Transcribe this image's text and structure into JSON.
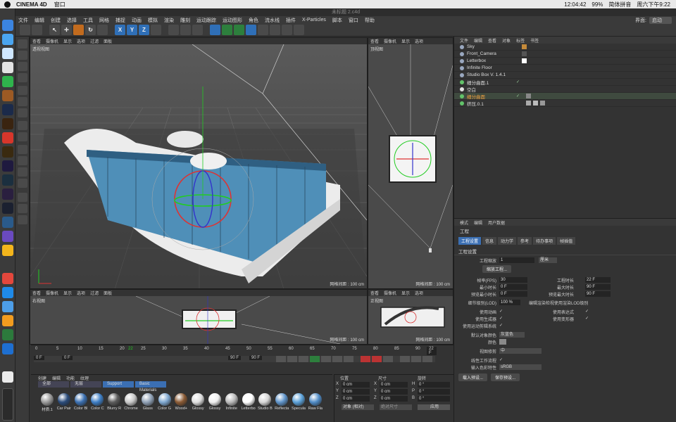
{
  "mac": {
    "app_name": "CINEMA 4D",
    "menu_window": "窗口",
    "time": "12:04:42",
    "battery": "99%",
    "input_method": "简体拼音",
    "clock": "周六下午9:22"
  },
  "window": {
    "title": "未标题 2.c4d"
  },
  "menu": [
    "文件",
    "编辑",
    "创建",
    "选择",
    "工具",
    "网格",
    "捕捉",
    "动画",
    "模拟",
    "渲染",
    "雕刻",
    "运动跟踪",
    "运动图形",
    "角色",
    "流水线",
    "插件",
    "X-Particles",
    "脚本",
    "窗口",
    "帮助"
  ],
  "layout": {
    "label": "界面:",
    "value": "启动"
  },
  "toolbar": {
    "axis_x": "X",
    "axis_y": "Y",
    "axis_z": "Z"
  },
  "viewports": {
    "perspective": {
      "menu": [
        "查看",
        "摄像机",
        "显示",
        "选项",
        "过滤",
        "面板"
      ],
      "label": "透视视图",
      "grid": "网格间距 : 100 cm"
    },
    "top": {
      "menu": [
        "查看",
        "摄像机",
        "显示",
        "选项",
        "过滤",
        "面板"
      ],
      "label": "顶视图",
      "grid": "网格间距 : 100 cm"
    },
    "right": {
      "menu": [
        "查看",
        "摄像机",
        "显示",
        "选项",
        "过滤",
        "面板"
      ],
      "label": "右视图",
      "grid": "网格间距 : 100 cm"
    },
    "front": {
      "menu": [
        "查看",
        "摄像机",
        "显示",
        "选项",
        "过滤",
        "面板"
      ],
      "label": "正视图",
      "grid": "网格间距 : 100 cm"
    }
  },
  "object_manager": {
    "menu": [
      "文件",
      "编辑",
      "查看",
      "对象",
      "标签",
      "书签"
    ],
    "objects": [
      {
        "name": "Sky",
        "color": "#9aa8c0"
      },
      {
        "name": "Front_Camera",
        "color": "#9aa8c0"
      },
      {
        "name": "Letterbox",
        "color": "#9aa8c0"
      },
      {
        "name": "Infinite Floor",
        "color": "#9aa8c0"
      },
      {
        "name": "Studio Box V. 1.4.1",
        "color": "#9aa8c0"
      },
      {
        "name": "细分曲面.1",
        "color": "#62c36a"
      },
      {
        "name": "空白",
        "color": "#e0e0e0"
      },
      {
        "name": "细分曲面",
        "color": "#62c36a"
      },
      {
        "name": "挤压.0.1",
        "color": "#62c36a"
      }
    ]
  },
  "attribute_manager": {
    "menu": [
      "模式",
      "编辑",
      "用户数据"
    ],
    "title": "工程",
    "tabs": [
      "工程设置",
      "信息",
      "动力学",
      "参考",
      "待办事项",
      "帧插值"
    ],
    "section": "工程设置",
    "rows": {
      "scale_label": "工程缩放",
      "scale_value": "1",
      "scale_unit": "厘米",
      "scale_btn": "缩放工程...",
      "fps_label": "帧率(FPS)",
      "fps_value": "30",
      "duration_label": "工程时长",
      "duration_value": "22 F",
      "min_label": "最小时长",
      "min_value": "0 F",
      "max_label": "最大时长",
      "max_value": "90 F",
      "pmin_label": "预览最小时长",
      "pmin_value": "0 F",
      "pmax_label": "预览最大时长",
      "pmax_value": "90 F",
      "lod_label": "细节级别(LOD)",
      "lod_value": "100 %",
      "lod_check": "编辑渲染检视使用渲染LOD级别",
      "use_anim": "使用动画",
      "use_expr": "使用表达式",
      "use_gen": "使用生成器",
      "use_deform": "使用变形器",
      "use_motion": "使用运动剪辑系统",
      "obj_color_label": "默认对象颜色",
      "obj_color_value": "灰蓝色",
      "color_label": "颜色",
      "view_clip_label": "视图修剪",
      "view_clip_value": "中",
      "linear_label": "线性工作流程",
      "input_color_label": "输入色彩特性",
      "input_color_value": "sRGB",
      "load_preset": "载入预设...",
      "save_preset": "保存预设..."
    }
  },
  "timeline": {
    "ticks": [
      "0",
      "5",
      "10",
      "15",
      "20",
      "22",
      "25",
      "30",
      "35",
      "40",
      "45",
      "50",
      "55",
      "60",
      "65",
      "70",
      "75",
      "80",
      "85",
      "90"
    ],
    "end_frame": "22 F",
    "start_field": "0 F",
    "min_field": "0 F",
    "max_field": "90 F",
    "max_field2": "90 F"
  },
  "material_manager": {
    "menu": [
      "创建",
      "编辑",
      "功能",
      "纹理"
    ],
    "tabs": [
      "全部",
      "无层",
      "Support",
      "Basic Materials"
    ],
    "materials": [
      {
        "name": "材质.1",
        "color": "#9a9a9a"
      },
      {
        "name": "Car Pair",
        "color": "#2a4b7a"
      },
      {
        "name": "Color Bl",
        "color": "#3a6fb0"
      },
      {
        "name": "Color C",
        "color": "#3d7ec5"
      },
      {
        "name": "Blurry R",
        "color": "#5c5c5c"
      },
      {
        "name": "Chrome",
        "color": "#c8c8c8"
      },
      {
        "name": "Glass",
        "color": "#8fa0b5"
      },
      {
        "name": "Color G",
        "color": "#7ea7d0"
      },
      {
        "name": "Wood+",
        "color": "#8a5a34"
      },
      {
        "name": "Glossy",
        "color": "#dedede"
      },
      {
        "name": "Glossy",
        "color": "#efefef"
      },
      {
        "name": "Infinite",
        "color": "#b9b9b9"
      },
      {
        "name": "Letterbo",
        "color": "#ffffff"
      },
      {
        "name": "Studio B",
        "color": "#d6d6d6"
      },
      {
        "name": "Reflecta",
        "color": "#5e93c9"
      },
      {
        "name": "Specula",
        "color": "#5aa0d8"
      },
      {
        "name": "Raw Fla",
        "color": "#4f8bc6"
      }
    ]
  },
  "coordinates": {
    "headers": [
      "位置",
      "尺寸",
      "旋转"
    ],
    "rows": [
      {
        "axis": "X",
        "pos": "0 cm",
        "size_axis": "X",
        "size": "0 cm",
        "rot_axis": "H",
        "rot": "0 °"
      },
      {
        "axis": "Y",
        "pos": "0 cm",
        "size_axis": "Y",
        "size": "0 cm",
        "rot_axis": "P",
        "rot": "0 °"
      },
      {
        "axis": "Z",
        "pos": "0 cm",
        "size_axis": "Z",
        "size": "0 cm",
        "rot_axis": "B",
        "rot": "0 °"
      }
    ],
    "mode": "对象 (相对)",
    "size_mode": "绝对尺寸",
    "apply": "应用"
  }
}
